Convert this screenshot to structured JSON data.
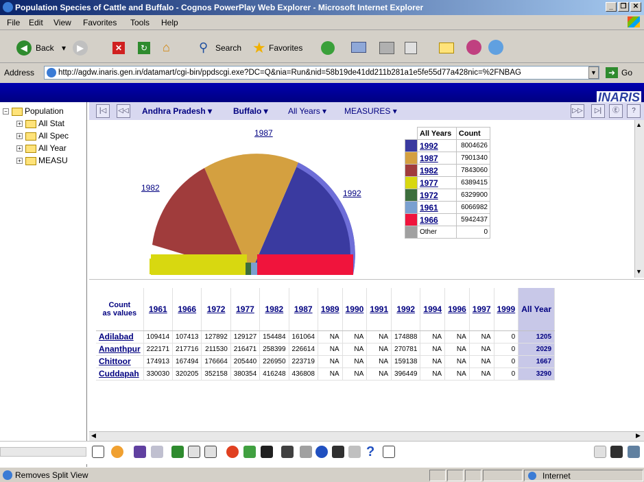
{
  "window": {
    "title": "Population Species of Cattle and Buffalo - Cognos PowerPlay Web Explorer - Microsoft Internet Explorer"
  },
  "menu": [
    "File",
    "Edit",
    "View",
    "Favorites",
    "Tools",
    "Help"
  ],
  "toolbar": {
    "back": "Back",
    "search": "Search",
    "favorites": "Favorites"
  },
  "address": {
    "label": "Address",
    "url": "http://agdw.inaris.gen.in/datamart/cgi-bin/ppdscgi.exe?DC=Q&nia=Run&nid=58b19de41dd211b281a1e5fe55d77a428nic=%2FNBAG",
    "go": "Go"
  },
  "brand": "INARIS",
  "tree": [
    "Population",
    "All Stat",
    "All Spec",
    "All Year",
    "MEASU"
  ],
  "dimbar": {
    "state": "Andhra Pradesh",
    "species": "Buffalo",
    "years": "All Years",
    "measures": "MEASURES"
  },
  "legend": {
    "header1": "All Years",
    "header2": "Count",
    "items": [
      {
        "label": "1992",
        "value": "8004626",
        "color": "#3a3aa0"
      },
      {
        "label": "1987",
        "value": "7901340",
        "color": "#d4a040"
      },
      {
        "label": "1982",
        "value": "7843060",
        "color": "#a03c3c"
      },
      {
        "label": "1977",
        "value": "6389415",
        "color": "#d8d810"
      },
      {
        "label": "1972",
        "value": "6329900",
        "color": "#3c6e3c"
      },
      {
        "label": "1961",
        "value": "6066982",
        "color": "#7aa0d0"
      },
      {
        "label": "1966",
        "value": "5942437",
        "color": "#f0143c"
      },
      {
        "label": "Other",
        "value": "0",
        "color": "#a0a0a0"
      }
    ]
  },
  "pie_labels": [
    "1987",
    "1982",
    "1992"
  ],
  "table": {
    "corner1": "Count",
    "corner2": "as values",
    "columns": [
      "1961",
      "1966",
      "1972",
      "1977",
      "1982",
      "1987",
      "1989",
      "1990",
      "1991",
      "1992",
      "1994",
      "1996",
      "1997",
      "1999"
    ],
    "total_header": "All Year",
    "rows": [
      {
        "name": "Adilabad",
        "vals": [
          "109414",
          "107413",
          "127892",
          "129127",
          "154484",
          "161064",
          "NA",
          "NA",
          "NA",
          "174888",
          "NA",
          "NA",
          "NA",
          "0"
        ],
        "total": "1205"
      },
      {
        "name": "Ananthpur",
        "vals": [
          "222171",
          "217716",
          "211530",
          "216471",
          "258399",
          "226614",
          "NA",
          "NA",
          "NA",
          "270781",
          "NA",
          "NA",
          "NA",
          "0"
        ],
        "total": "2029"
      },
      {
        "name": "Chittoor",
        "vals": [
          "174913",
          "167494",
          "176664",
          "205440",
          "226950",
          "223719",
          "NA",
          "NA",
          "NA",
          "159138",
          "NA",
          "NA",
          "NA",
          "0"
        ],
        "total": "1667"
      },
      {
        "name": "Cuddapah",
        "vals": [
          "330030",
          "320205",
          "352158",
          "380354",
          "416248",
          "436808",
          "NA",
          "NA",
          "NA",
          "396449",
          "NA",
          "NA",
          "NA",
          "0"
        ],
        "total": "3290"
      }
    ]
  },
  "status": {
    "text": "Removes Split View",
    "zone": "Internet"
  }
}
